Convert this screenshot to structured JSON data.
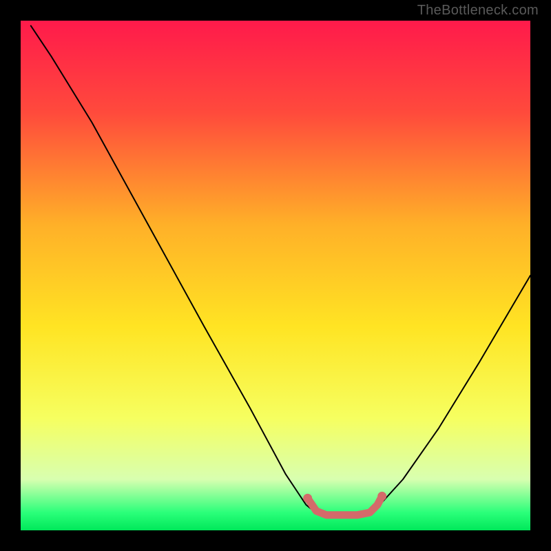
{
  "watermark": "TheBottleneck.com",
  "chart_data": {
    "type": "line",
    "title": "",
    "xlabel": "",
    "ylabel": "",
    "xlim": [
      0,
      100
    ],
    "ylim": [
      0,
      100
    ],
    "background_gradient": {
      "stops": [
        {
          "offset": 0.0,
          "color": "#ff1a4b"
        },
        {
          "offset": 0.18,
          "color": "#ff4a3c"
        },
        {
          "offset": 0.4,
          "color": "#ffb028"
        },
        {
          "offset": 0.6,
          "color": "#ffe423"
        },
        {
          "offset": 0.78,
          "color": "#f6ff60"
        },
        {
          "offset": 0.9,
          "color": "#d8ffb0"
        },
        {
          "offset": 0.965,
          "color": "#2bff7a"
        },
        {
          "offset": 1.0,
          "color": "#00e85a"
        }
      ]
    },
    "series": [
      {
        "name": "bottleneck-curve",
        "color": "#000000",
        "width": 2,
        "points": [
          {
            "x": 2.0,
            "y": 99.0
          },
          {
            "x": 6.0,
            "y": 93.0
          },
          {
            "x": 14.0,
            "y": 80.0
          },
          {
            "x": 25.0,
            "y": 60.0
          },
          {
            "x": 36.0,
            "y": 40.0
          },
          {
            "x": 45.0,
            "y": 24.0
          },
          {
            "x": 52.0,
            "y": 11.0
          },
          {
            "x": 56.0,
            "y": 5.0
          },
          {
            "x": 58.5,
            "y": 3.0
          },
          {
            "x": 61.0,
            "y": 3.0
          },
          {
            "x": 64.0,
            "y": 3.0
          },
          {
            "x": 67.0,
            "y": 3.0
          },
          {
            "x": 70.0,
            "y": 4.5
          },
          {
            "x": 75.0,
            "y": 10.0
          },
          {
            "x": 82.0,
            "y": 20.0
          },
          {
            "x": 90.0,
            "y": 33.0
          },
          {
            "x": 100.0,
            "y": 50.0
          }
        ]
      },
      {
        "name": "optimal-marker",
        "color": "#d46a6a",
        "width": 11,
        "points": [
          {
            "x": 56.5,
            "y": 6.0
          },
          {
            "x": 58.0,
            "y": 3.8
          },
          {
            "x": 60.0,
            "y": 3.0
          },
          {
            "x": 63.0,
            "y": 3.0
          },
          {
            "x": 66.0,
            "y": 3.0
          },
          {
            "x": 68.5,
            "y": 3.5
          },
          {
            "x": 70.0,
            "y": 5.0
          },
          {
            "x": 70.8,
            "y": 6.5
          }
        ]
      },
      {
        "name": "optimal-marker-dot-left",
        "color": "#d46a6a",
        "type": "dot",
        "radius": 6.5,
        "points": [
          {
            "x": 56.3,
            "y": 6.3
          }
        ]
      },
      {
        "name": "optimal-marker-dot-right",
        "color": "#d46a6a",
        "type": "dot",
        "radius": 6.5,
        "points": [
          {
            "x": 70.9,
            "y": 6.7
          }
        ]
      }
    ]
  }
}
